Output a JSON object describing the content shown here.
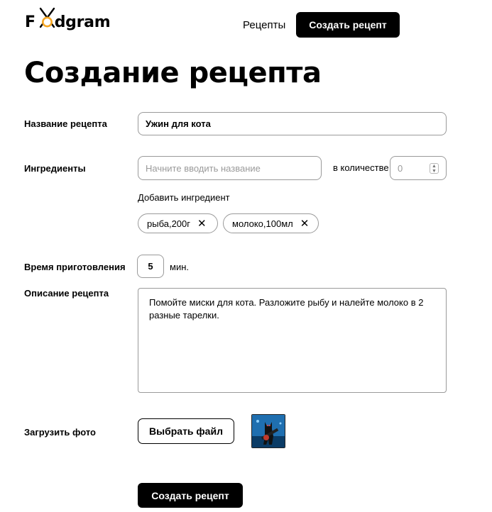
{
  "header": {
    "logo_text": "Foodgram",
    "nav_recipes": "Рецепты",
    "create_button": "Создать рецепт"
  },
  "page": {
    "title": "Создание рецепта"
  },
  "form": {
    "name_label": "Название рецепта",
    "name_value": "Ужин для кота",
    "ingredients_label": "Ингредиенты",
    "ingredient_placeholder": "Начните вводить название",
    "quantity_label": "в количестве",
    "quantity_placeholder": "0",
    "add_ingredient": "Добавить ингредиент",
    "chips": [
      {
        "label": "рыба,200г"
      },
      {
        "label": "молоко,100мл"
      }
    ],
    "time_label": "Время приготовления",
    "time_value": "5",
    "time_unit": "мин.",
    "description_label": "Описание рецепта",
    "description_value": "Помойте миски для кота. Разложите рыбу и налейте молоко в 2 разные тарелки.",
    "photo_label": "Загрузить фото",
    "file_button": "Выбрать файл",
    "submit_button": "Создать рецепт"
  },
  "colors": {
    "accent": "#000000",
    "border": "#9a9a9a",
    "logo_accent": "#f5a623"
  },
  "icons": [
    "fork-knife-icon",
    "close-icon",
    "spinner-arrows-icon",
    "photo-thumbnail"
  ]
}
